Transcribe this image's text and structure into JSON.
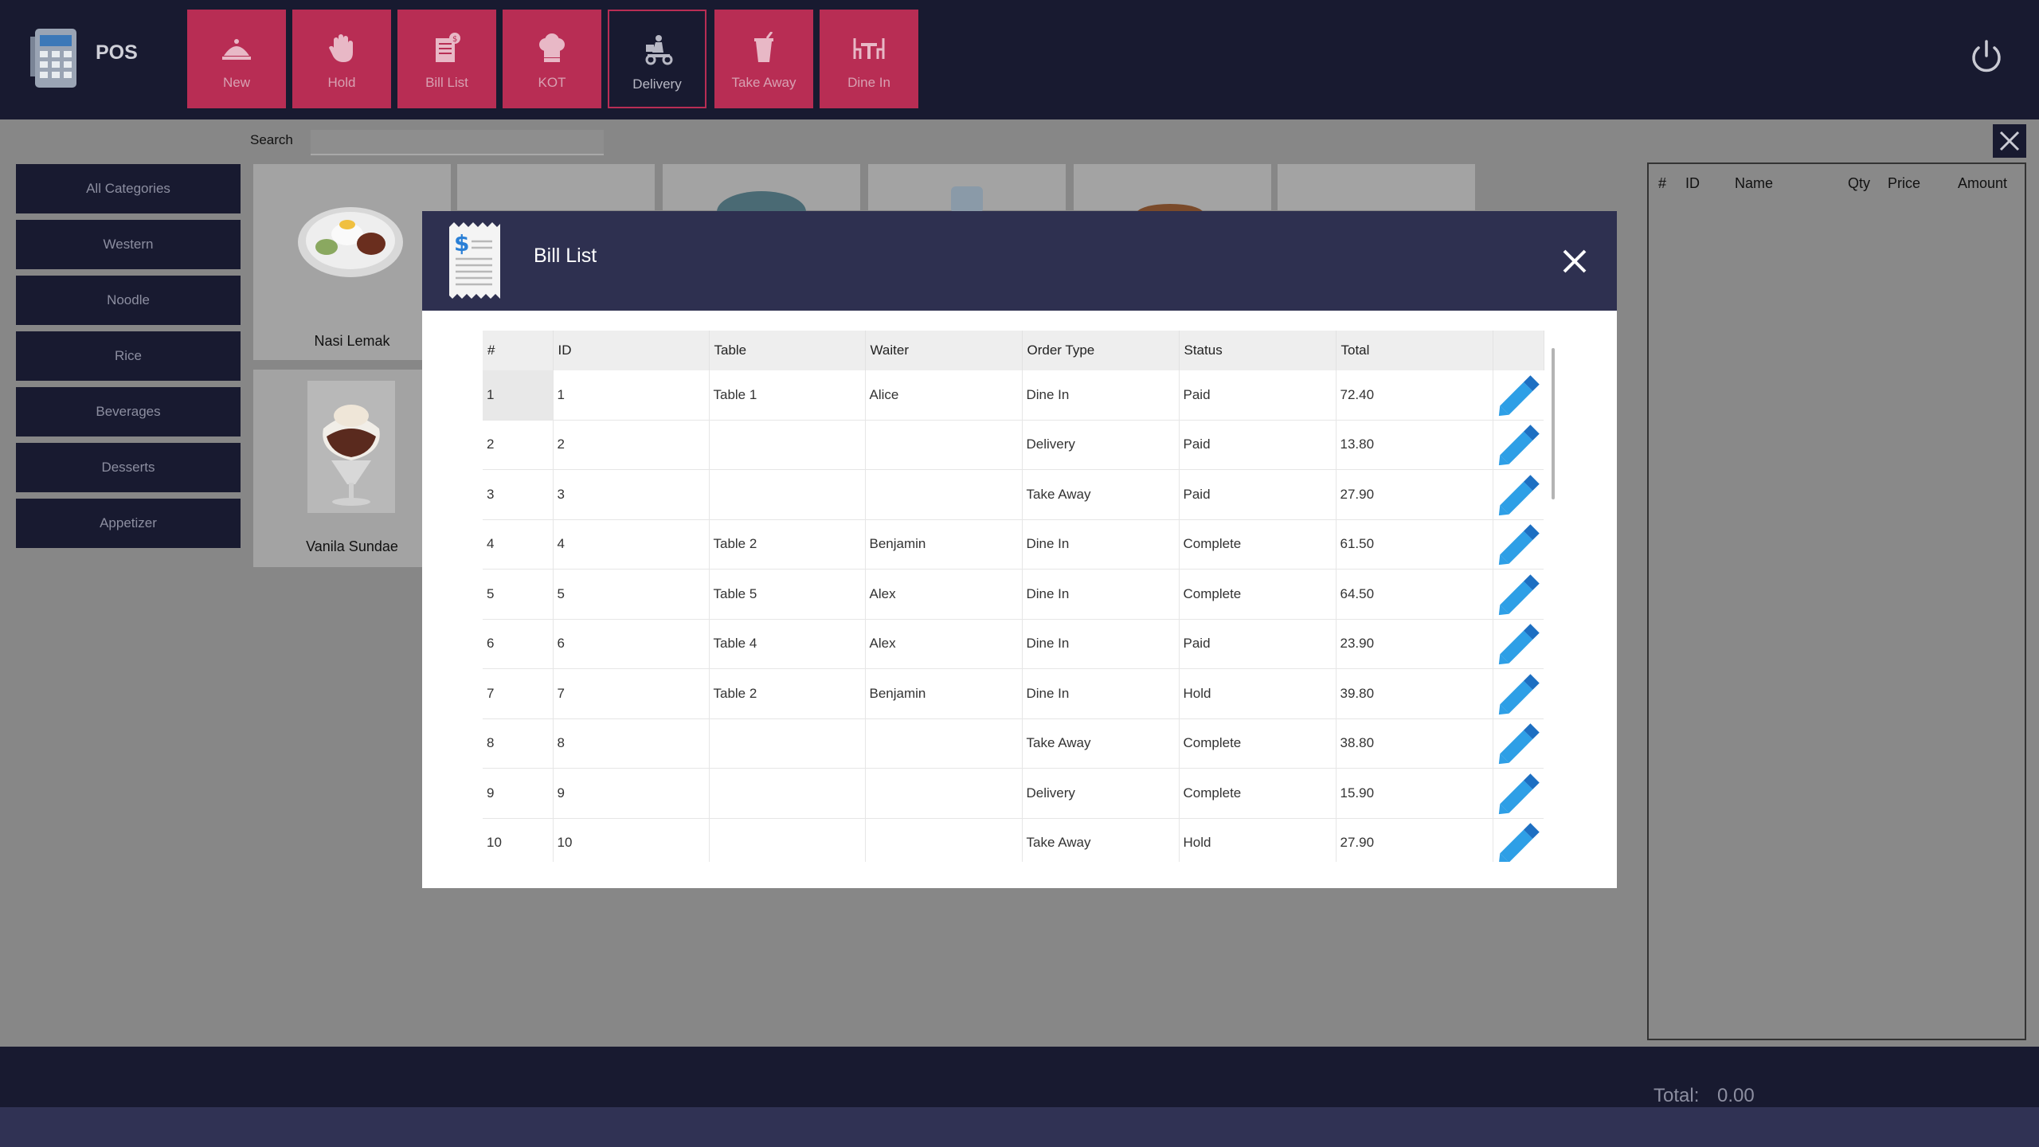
{
  "app": {
    "title": "POS"
  },
  "colors": {
    "accent": "#b82d54",
    "nav": "#181a30",
    "modal_header": "#2e3050",
    "edit_icon": "#2e9fe6"
  },
  "toolbar": [
    {
      "label": "New",
      "icon": "dish-cover-icon"
    },
    {
      "label": "Hold",
      "icon": "hand-icon"
    },
    {
      "label": "Bill List",
      "icon": "bill-list-icon"
    },
    {
      "label": "KOT",
      "icon": "chef-hat-icon"
    },
    {
      "label": "Delivery",
      "icon": "scooter-icon",
      "active": true
    },
    {
      "label": "Take Away",
      "icon": "takeaway-cup-icon"
    },
    {
      "label": "Dine In",
      "icon": "table-chairs-icon"
    }
  ],
  "search": {
    "label": "Search",
    "value": ""
  },
  "categories": [
    "All Categories",
    "Western",
    "Noodle",
    "Rice",
    "Beverages",
    "Desserts",
    "Appetizer"
  ],
  "products": [
    "Nasi Lemak",
    "Vanila Sundae"
  ],
  "order_table": {
    "columns": [
      "#",
      "ID",
      "Name",
      "Qty",
      "Price",
      "Amount"
    ]
  },
  "footer": {
    "total_label": "Total:",
    "total_value": "0.00"
  },
  "bill_list": {
    "title": "Bill List",
    "columns": [
      "#",
      "ID",
      "Table",
      "Waiter",
      "Order Type",
      "Status",
      "Total"
    ],
    "rows": [
      {
        "num": "1",
        "id": "1",
        "table": "Table 1",
        "waiter": "Alice",
        "order_type": "Dine In",
        "status": "Paid",
        "total": "72.40"
      },
      {
        "num": "2",
        "id": "2",
        "table": "",
        "waiter": "",
        "order_type": "Delivery",
        "status": "Paid",
        "total": "13.80"
      },
      {
        "num": "3",
        "id": "3",
        "table": "",
        "waiter": "",
        "order_type": "Take Away",
        "status": "Paid",
        "total": "27.90"
      },
      {
        "num": "4",
        "id": "4",
        "table": "Table 2",
        "waiter": "Benjamin",
        "order_type": "Dine In",
        "status": "Complete",
        "total": "61.50"
      },
      {
        "num": "5",
        "id": "5",
        "table": "Table 5",
        "waiter": "Alex",
        "order_type": "Dine In",
        "status": "Complete",
        "total": "64.50"
      },
      {
        "num": "6",
        "id": "6",
        "table": "Table 4",
        "waiter": "Alex",
        "order_type": "Dine In",
        "status": "Paid",
        "total": "23.90"
      },
      {
        "num": "7",
        "id": "7",
        "table": "Table 2",
        "waiter": "Benjamin",
        "order_type": "Dine In",
        "status": "Hold",
        "total": "39.80"
      },
      {
        "num": "8",
        "id": "8",
        "table": "",
        "waiter": "",
        "order_type": "Take Away",
        "status": "Complete",
        "total": "38.80"
      },
      {
        "num": "9",
        "id": "9",
        "table": "",
        "waiter": "",
        "order_type": "Delivery",
        "status": "Complete",
        "total": "15.90"
      },
      {
        "num": "10",
        "id": "10",
        "table": "",
        "waiter": "",
        "order_type": "Take Away",
        "status": "Hold",
        "total": "27.90"
      }
    ]
  }
}
